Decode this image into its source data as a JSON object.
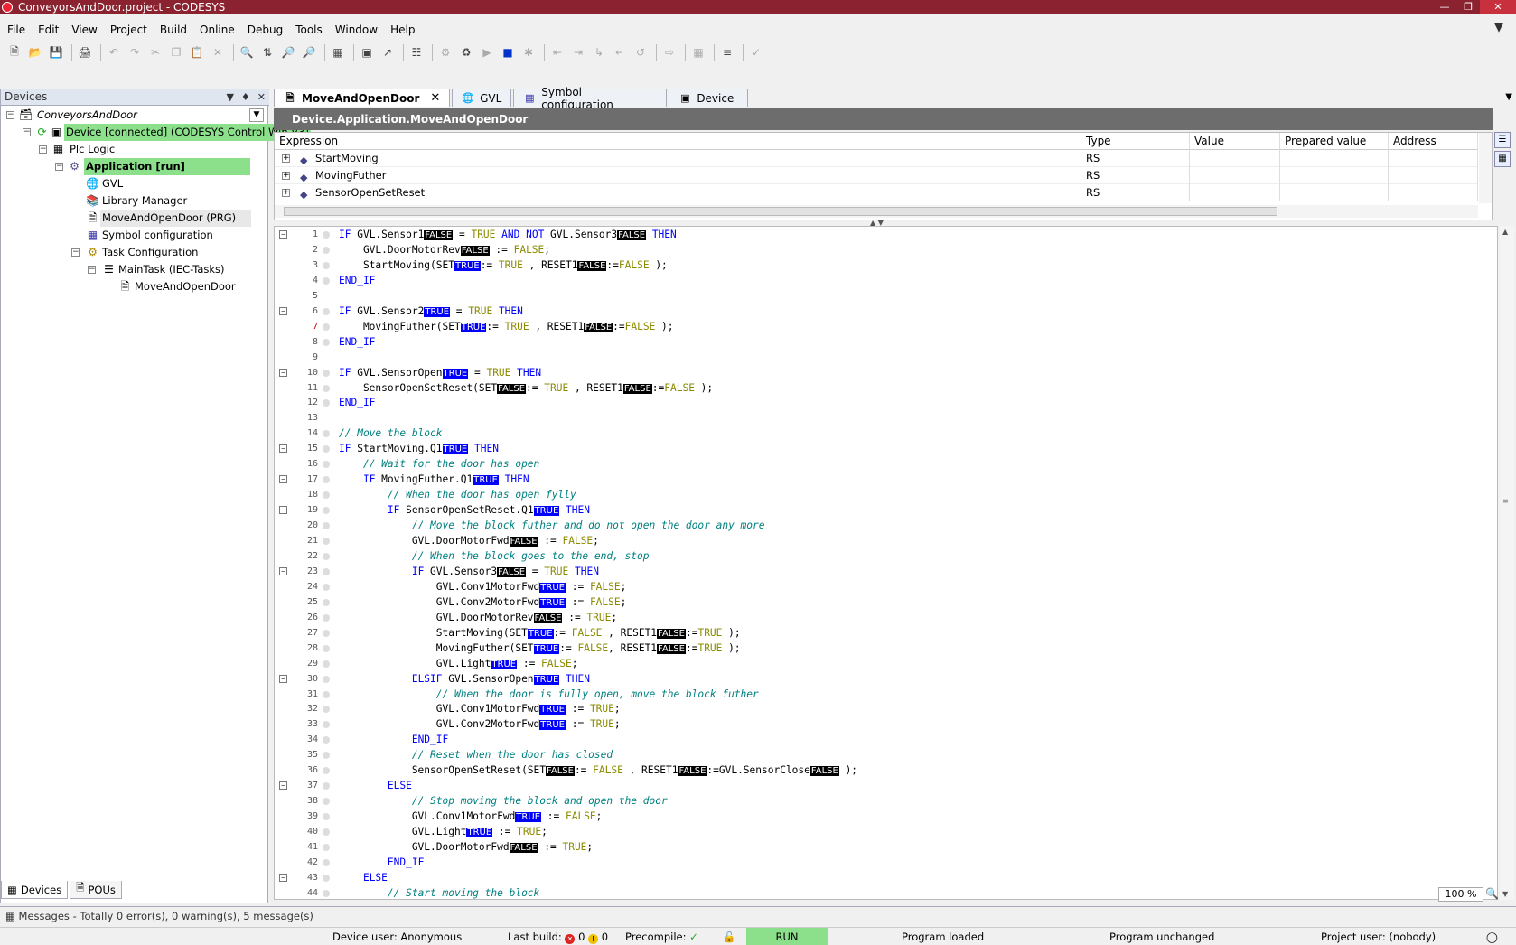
{
  "window": {
    "title": "ConveyorsAndDoor.project - CODESYS"
  },
  "menu": [
    "File",
    "Edit",
    "View",
    "Project",
    "Build",
    "Online",
    "Debug",
    "Tools",
    "Window",
    "Help"
  ],
  "devices_pane": {
    "title": "Devices",
    "tree": [
      {
        "label": "ConveyorsAndDoor",
        "style": "italic"
      },
      {
        "label": "Device [connected] (CODESYS Control Win V3)",
        "style": "green"
      },
      {
        "label": "Plc Logic",
        "style": ""
      },
      {
        "label": "Application [run]",
        "style": "green-bold"
      },
      {
        "label": "GVL",
        "style": ""
      },
      {
        "label": "Library Manager",
        "style": ""
      },
      {
        "label": "MoveAndOpenDoor (PRG)",
        "style": "sel"
      },
      {
        "label": "Symbol configuration",
        "style": ""
      },
      {
        "label": "Task Configuration",
        "style": ""
      },
      {
        "label": "MainTask (IEC-Tasks)",
        "style": ""
      },
      {
        "label": "MoveAndOpenDoor",
        "style": ""
      }
    ],
    "bottom_tabs": [
      "Devices",
      "POUs"
    ]
  },
  "editor": {
    "tabs": [
      "MoveAndOpenDoor",
      "GVL",
      "Symbol configuration",
      "Device"
    ],
    "path": "Device.Application.MoveAndOpenDoor",
    "watch": {
      "columns": [
        "Expression",
        "Type",
        "Value",
        "Prepared value",
        "Address"
      ],
      "rows": [
        {
          "expr": "StartMoving",
          "type": "RS"
        },
        {
          "expr": "MovingFuther",
          "type": "RS"
        },
        {
          "expr": "SensorOpenSetReset",
          "type": "RS"
        }
      ]
    },
    "zoom": "100 %",
    "code_lines": [
      "<span class=kw>IF</span> GVL.Sensor1<span class=bf>FALSE</span> = <span class=val>TRUE</span> <span class=kw>AND NOT</span> GVL.Sensor3<span class=bf>FALSE</span> <span class=kw>THEN</span>",
      "    GVL.DoorMotorRev<span class=bf>FALSE</span> := <span class=val>FALSE</span>;",
      "    StartMoving(SET<span class=bt>TRUE</span>:= <span class=val>TRUE</span> , RESET1<span class=bf>FALSE</span>:=<span class=val>FALSE</span> );",
      "<span class=kw>END_IF</span>",
      "",
      "<span class=kw>IF</span> GVL.Sensor2<span class=bt>TRUE</span> = <span class=val>TRUE</span> <span class=kw>THEN</span>",
      "    MovingFuther(SET<span class=bt>TRUE</span>:= <span class=val>TRUE</span> , RESET1<span class=bf>FALSE</span>:=<span class=val>FALSE</span> );",
      "<span class=kw>END_IF</span>",
      "",
      "<span class=kw>IF</span> GVL.SensorOpen<span class=bt>TRUE</span> = <span class=val>TRUE</span> <span class=kw>THEN</span>",
      "    SensorOpenSetReset(SET<span class=bf>FALSE</span>:= <span class=val>TRUE</span> , RESET1<span class=bf>FALSE</span>:=<span class=val>FALSE</span> );",
      "<span class=kw>END_IF</span>",
      "",
      "<span class=cm>// Move the block</span>",
      "<span class=kw>IF</span> StartMoving.Q1<span class=bt>TRUE</span> <span class=kw>THEN</span>",
      "    <span class=cm>// Wait for the door has open</span>",
      "    <span class=kw>IF</span> MovingFuther.Q1<span class=bt>TRUE</span> <span class=kw>THEN</span>",
      "        <span class=cm>// When the door has open fylly</span>",
      "        <span class=kw>IF</span> SensorOpenSetReset.Q1<span class=bt>TRUE</span> <span class=kw>THEN</span>",
      "            <span class=cm>// Move the block futher and do not open the door any more</span>",
      "            GVL.DoorMotorFwd<span class=bf>FALSE</span> := <span class=val>FALSE</span>;",
      "            <span class=cm>// When the block goes to the end, stop</span>",
      "            <span class=kw>IF</span> GVL.Sensor3<span class=bf>FALSE</span> = <span class=val>TRUE</span> <span class=kw>THEN</span>",
      "                GVL.Conv1MotorFwd<span class=bt>TRUE</span> := <span class=val>FALSE</span>;",
      "                GVL.Conv2MotorFwd<span class=bt>TRUE</span> := <span class=val>FALSE</span>;",
      "                GVL.DoorMotorRev<span class=bf>FALSE</span> := <span class=val>TRUE</span>;",
      "                StartMoving(SET<span class=bt>TRUE</span>:= <span class=val>FALSE</span> , RESET1<span class=bf>FALSE</span>:=<span class=val>TRUE</span> );",
      "                MovingFuther(SET<span class=bt>TRUE</span>:= <span class=val>FALSE</span>, RESET1<span class=bf>FALSE</span>:=<span class=val>TRUE</span> );",
      "                GVL.Light<span class=bt>TRUE</span> := <span class=val>FALSE</span>;",
      "            <span class=kw>ELSIF</span> GVL.SensorOpen<span class=bt>TRUE</span> <span class=kw>THEN</span>",
      "                <span class=cm>// When the door is fully open, move the block futher</span>",
      "                GVL.Conv1MotorFwd<span class=bt>TRUE</span> := <span class=val>TRUE</span>;",
      "                GVL.Conv2MotorFwd<span class=bt>TRUE</span> := <span class=val>TRUE</span>;",
      "            <span class=kw>END_IF</span>",
      "            <span class=cm>// Reset when the door has closed</span>",
      "            SensorOpenSetReset(SET<span class=bf>FALSE</span>:= <span class=val>FALSE</span> , RESET1<span class=bf>FALSE</span>:=GVL.SensorClose<span class=bf>FALSE</span> );",
      "        <span class=kw>ELSE</span>",
      "            <span class=cm>// Stop moving the block and open the door</span>",
      "            GVL.Conv1MotorFwd<span class=bt>TRUE</span> := <span class=val>FALSE</span>;",
      "            GVL.Light<span class=bt>TRUE</span> := <span class=val>TRUE</span>;",
      "            GVL.DoorMotorFwd<span class=bf>FALSE</span> := <span class=val>TRUE</span>;",
      "        <span class=kw>END_IF</span>",
      "    <span class=kw>ELSE</span>",
      "        <span class=cm>// Start moving the block</span>"
    ],
    "fold_lines": [
      1,
      6,
      10,
      15,
      17,
      19,
      23,
      30,
      37,
      43
    ],
    "red_line": 7
  },
  "messages": {
    "text": "Messages - Totally 0 error(s), 0 warning(s), 5 message(s)"
  },
  "status": {
    "device_user": "Device user: Anonymous",
    "last_build": "Last build:",
    "err_count": "0",
    "warn_count": "0",
    "precompile": "Precompile:",
    "run": "RUN",
    "program_loaded": "Program loaded",
    "program_unchanged": "Program unchanged",
    "project_user": "Project user: (nobody)"
  },
  "colors": {
    "title_bar": "#8b2230",
    "run_green": "#8ce08c",
    "true_badge": "#0000ff",
    "false_badge": "#000000"
  }
}
